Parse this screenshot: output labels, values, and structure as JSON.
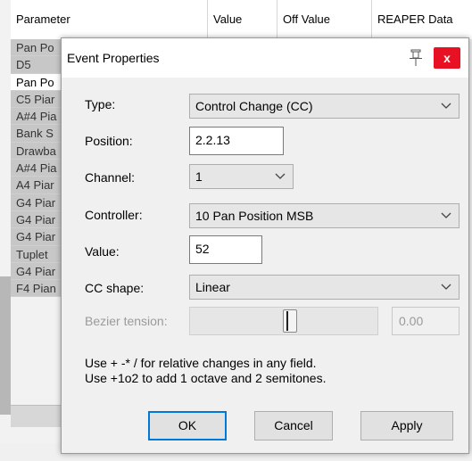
{
  "background_table": {
    "columns": [
      "Parameter",
      "Value",
      "Off Value",
      "REAPER Data"
    ],
    "rows": [
      {
        "label": "Pan Po"
      },
      {
        "label": "D5"
      },
      {
        "label": "Pan Po"
      },
      {
        "label": "C5 Piar"
      },
      {
        "label": "A#4 Pia"
      },
      {
        "label": "Bank S"
      },
      {
        "label": "Drawba"
      },
      {
        "label": "A#4 Pia"
      },
      {
        "label": "A4 Piar"
      },
      {
        "label": "G4 Piar"
      },
      {
        "label": "G4 Piar"
      },
      {
        "label": "G4 Piar"
      },
      {
        "label": "Tuplet"
      },
      {
        "label": "G4 Piar"
      },
      {
        "label": "F4 Pian"
      }
    ],
    "edge_mark": ")"
  },
  "dialog": {
    "title": "Event Properties",
    "pin_icon": "pin-icon",
    "close_label": "x",
    "close_color": "#e81123",
    "fields": {
      "type_label": "Type:",
      "type_value": "Control Change (CC)",
      "position_label": "Position:",
      "position_value": "2.2.13",
      "channel_label": "Channel:",
      "channel_value": "1",
      "controller_label": "Controller:",
      "controller_value": "10 Pan Position MSB",
      "value_label": "Value:",
      "value_value": "52",
      "cc_shape_label": "CC shape:",
      "cc_shape_value": "Linear",
      "bezier_label": "Bezier tension:",
      "bezier_value": "0.00"
    },
    "hints": [
      "Use + -* / for relative changes in any field.",
      "Use +1o2  to add 1 octave and 2 semitones."
    ],
    "buttons": {
      "ok": "OK",
      "cancel": "Cancel",
      "apply": "Apply"
    },
    "accent": "#0078d7"
  }
}
